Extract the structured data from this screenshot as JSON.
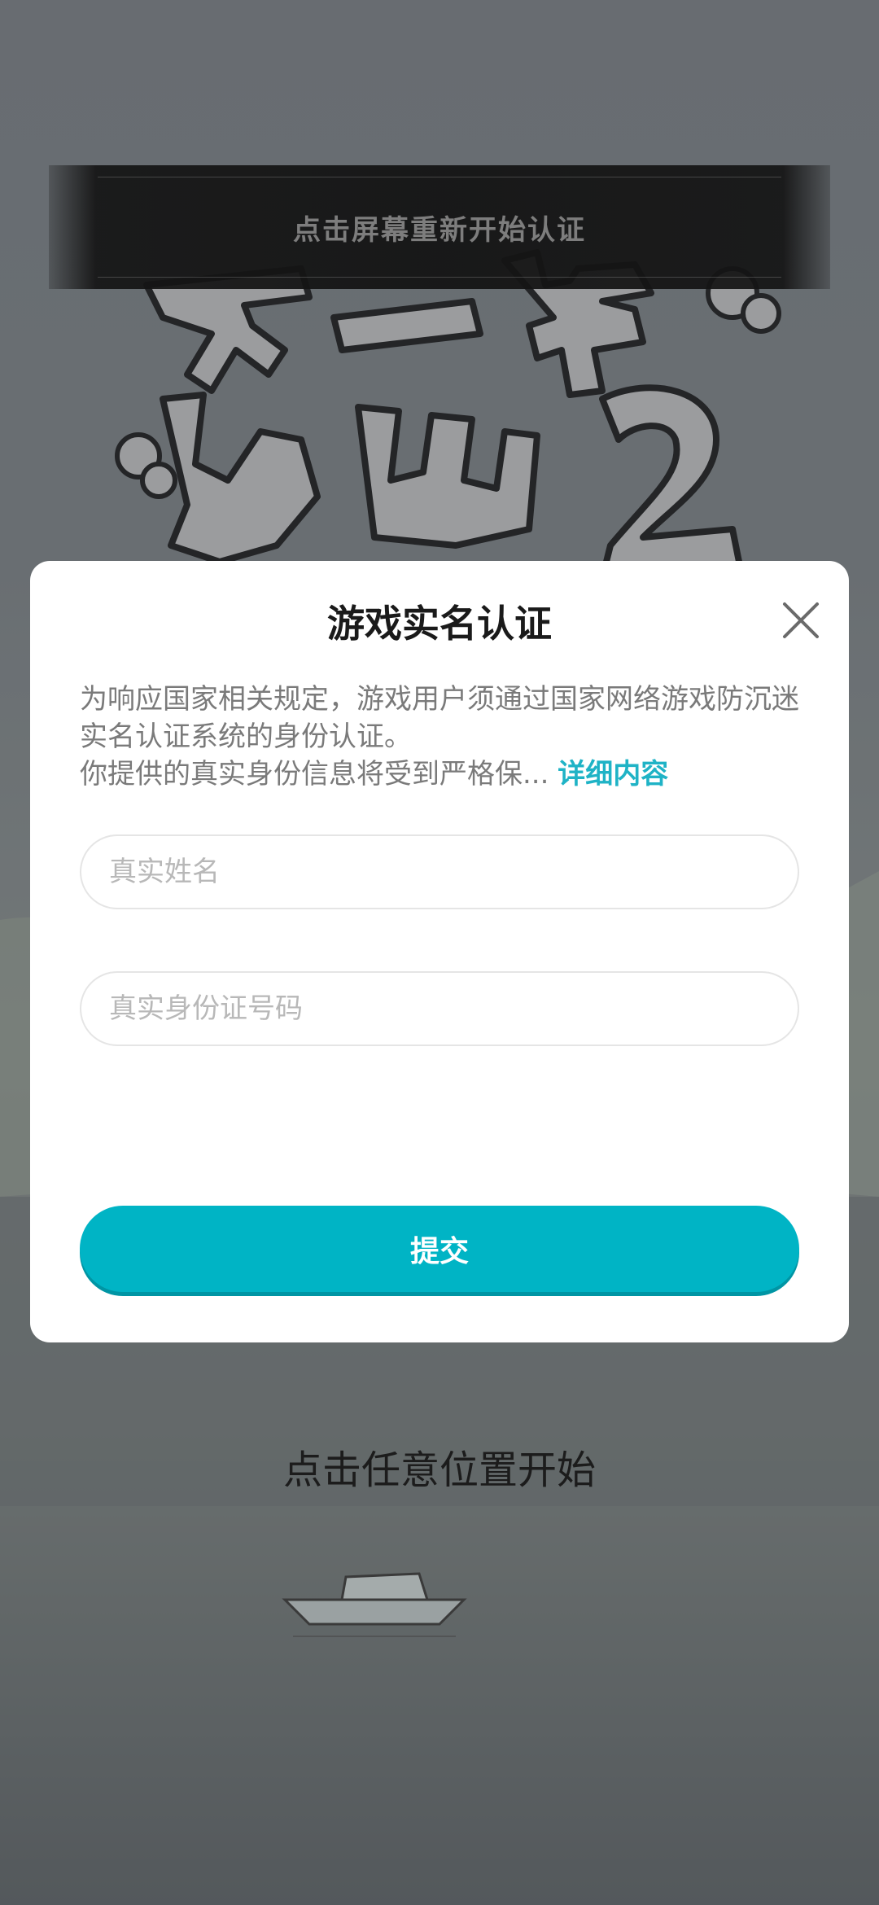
{
  "background": {
    "banner_text": "点击屏幕重新开始认证",
    "start_prompt": "点击任意位置开始"
  },
  "dialog": {
    "title": "游戏实名认证",
    "notice_line1": "为响应国家相关规定，游戏用户须通过国家网络游戏防沉迷实名认证系统的身份认证。",
    "notice_line2": "你提供的真实身份信息将受到严格保...",
    "detail_link": "详细内容",
    "name_placeholder": "真实姓名",
    "id_placeholder": "真实身份证号码",
    "submit_label": "提交"
  },
  "colors": {
    "accent": "#00b4c5",
    "link": "#1fb3c6"
  }
}
